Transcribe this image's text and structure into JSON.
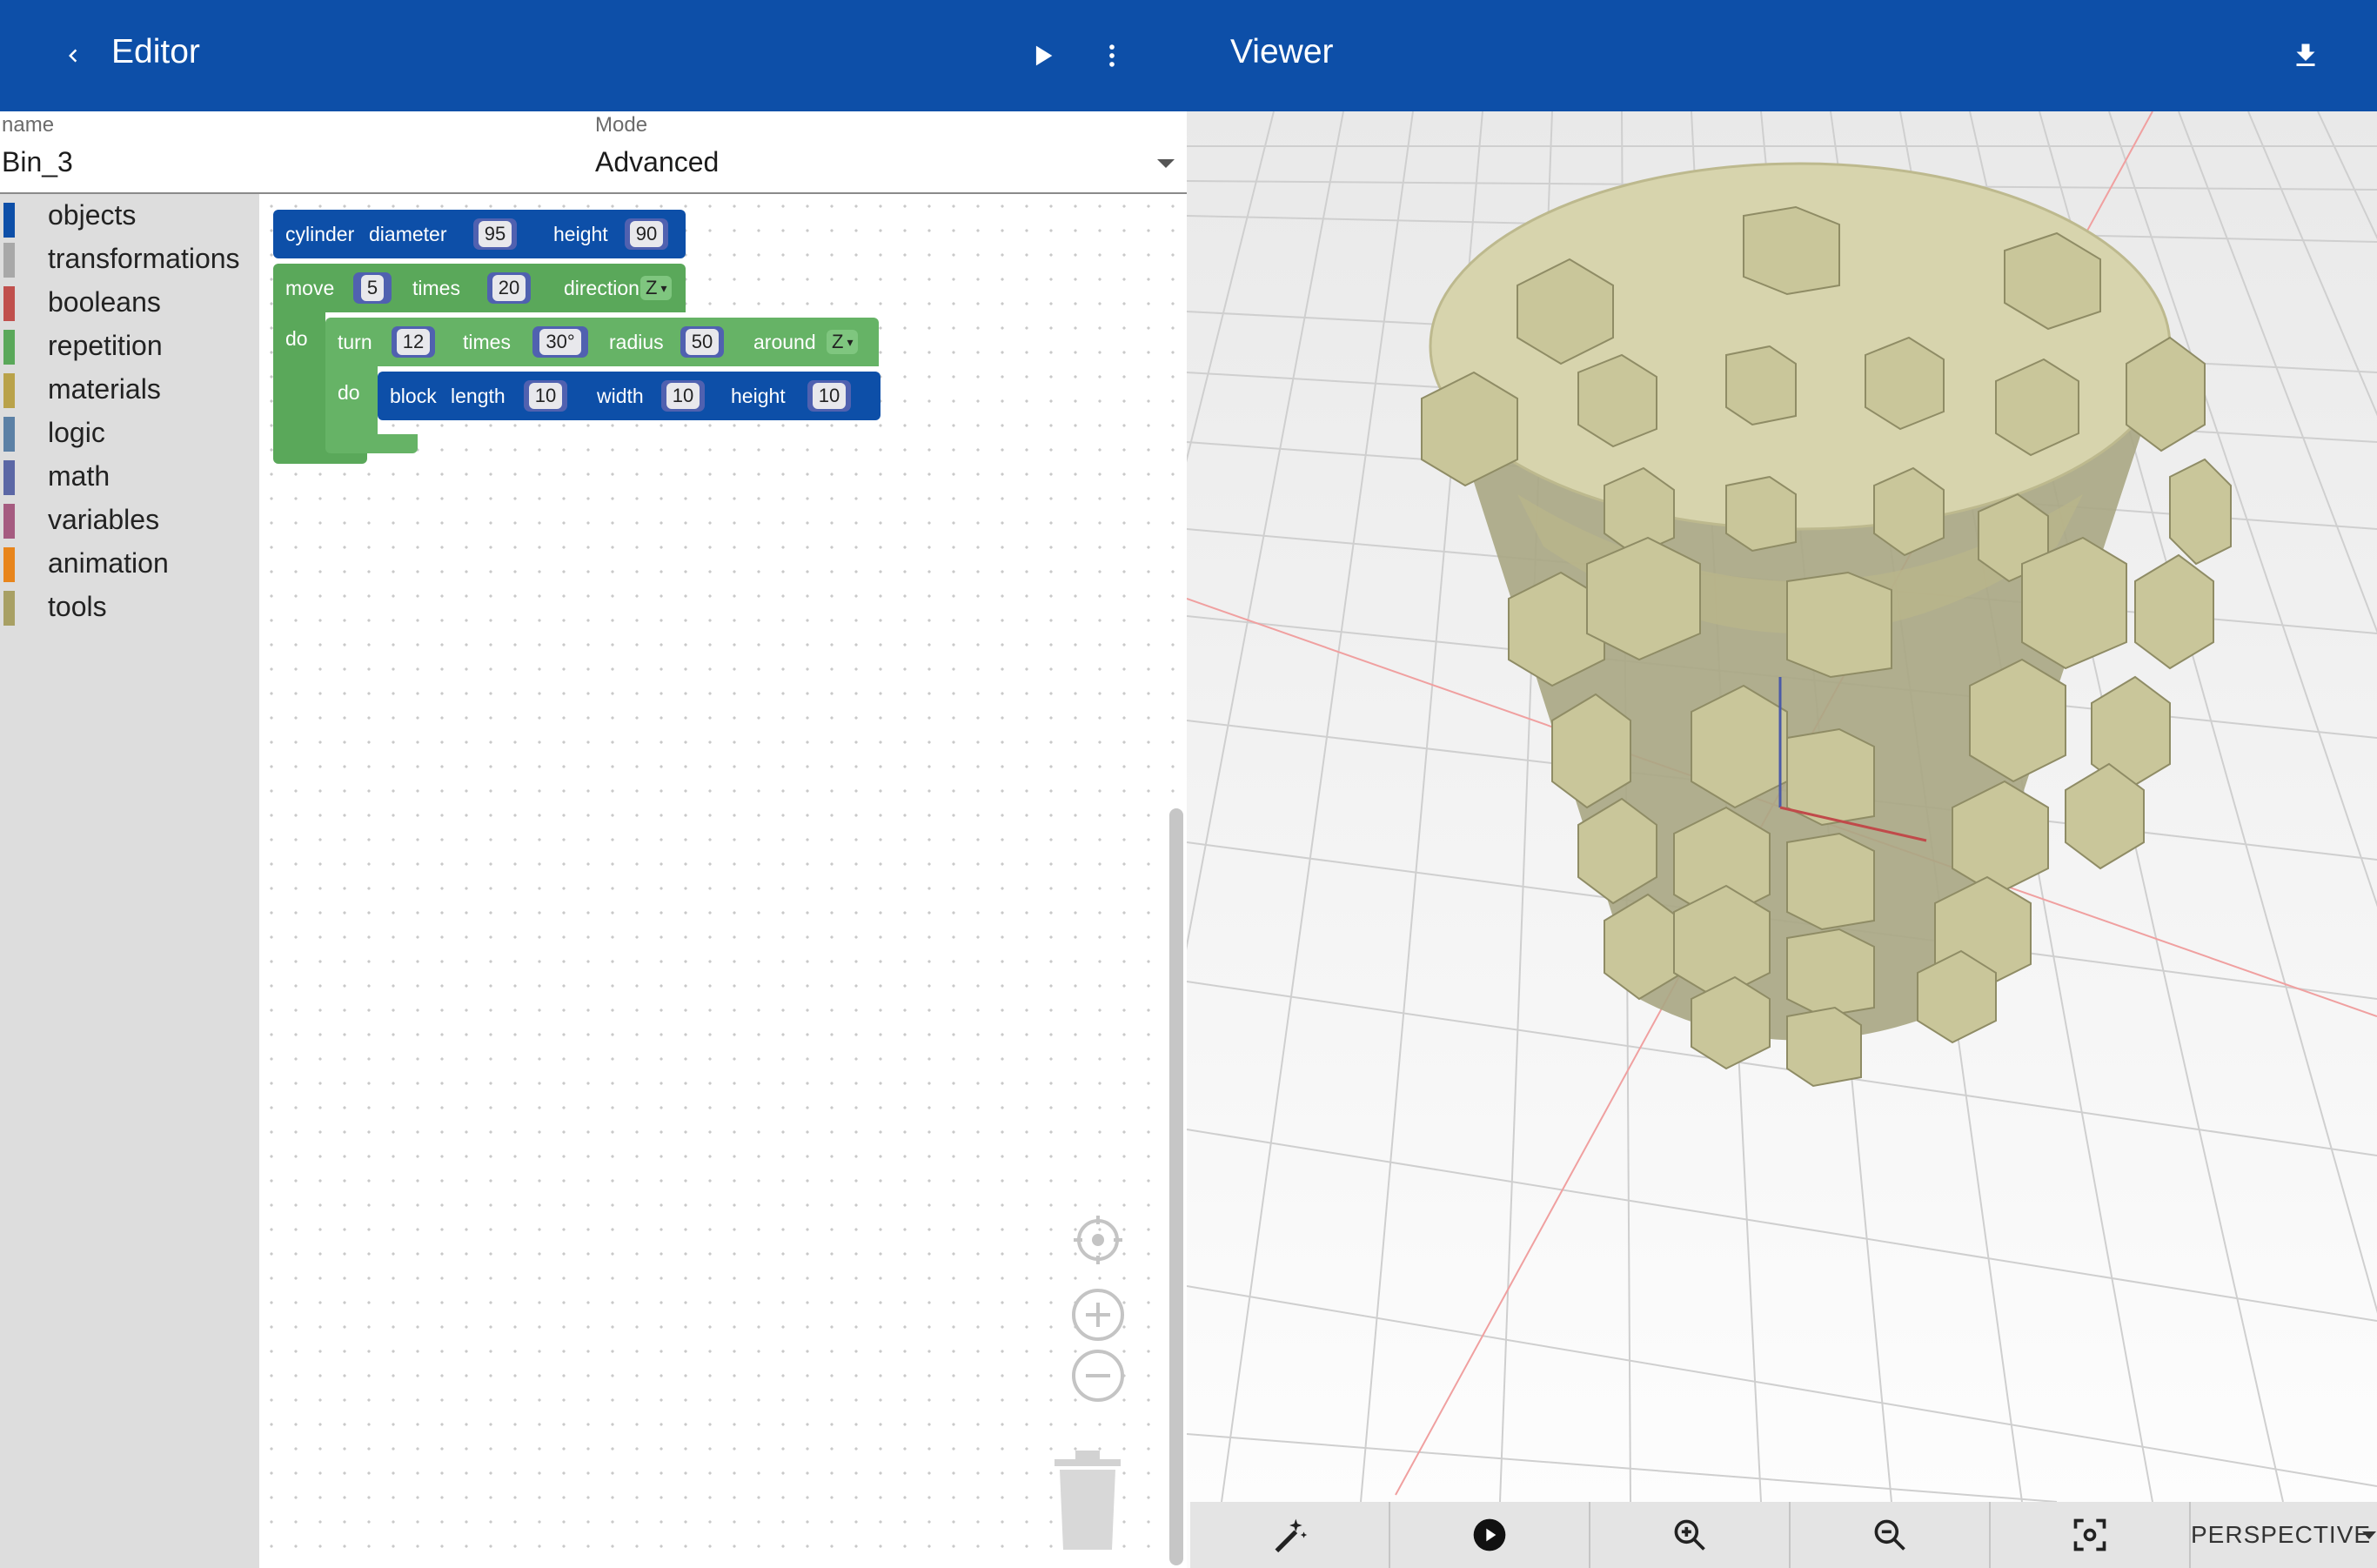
{
  "editor": {
    "title": "Editor",
    "name_label": "name",
    "name_value": "Bin_3",
    "mode_label": "Mode",
    "mode_value": "Advanced"
  },
  "toolbox": [
    {
      "label": "objects",
      "color": "#0d4fa8"
    },
    {
      "label": "transformations",
      "color": "#a8a8a8"
    },
    {
      "label": "booleans",
      "color": "#c0504d"
    },
    {
      "label": "repetition",
      "color": "#5aa85a"
    },
    {
      "label": "materials",
      "color": "#b9a24a"
    },
    {
      "label": "logic",
      "color": "#5b80a5"
    },
    {
      "label": "math",
      "color": "#5b67a5"
    },
    {
      "label": "variables",
      "color": "#a55b80"
    },
    {
      "label": "animation",
      "color": "#e8851c"
    },
    {
      "label": "tools",
      "color": "#a8a064"
    }
  ],
  "blocks": {
    "cylinder": {
      "name": "cylinder",
      "p1": "diameter",
      "v1": "95",
      "p2": "height",
      "v2": "90"
    },
    "move": {
      "name": "move",
      "v1": "5",
      "p1": "times",
      "v2": "20",
      "p2": "direction",
      "dir": "Z",
      "do": "do"
    },
    "turn": {
      "name": "turn",
      "v1": "12",
      "p1": "times",
      "v2": "30°",
      "p2": "radius",
      "v3": "50",
      "p3": "around",
      "dir": "Z",
      "do": "do"
    },
    "block": {
      "name": "block",
      "p1": "length",
      "v1": "10",
      "p2": "width",
      "v2": "10",
      "p3": "height",
      "v3": "10"
    }
  },
  "viewer": {
    "title": "Viewer",
    "camera_mode": "PERSPECTIVE"
  },
  "colors": {
    "appbar": "#0d4fa8",
    "objects_block": "#0d4fa8",
    "repetition_block": "#5aa85a",
    "model": "#c9c69a"
  }
}
